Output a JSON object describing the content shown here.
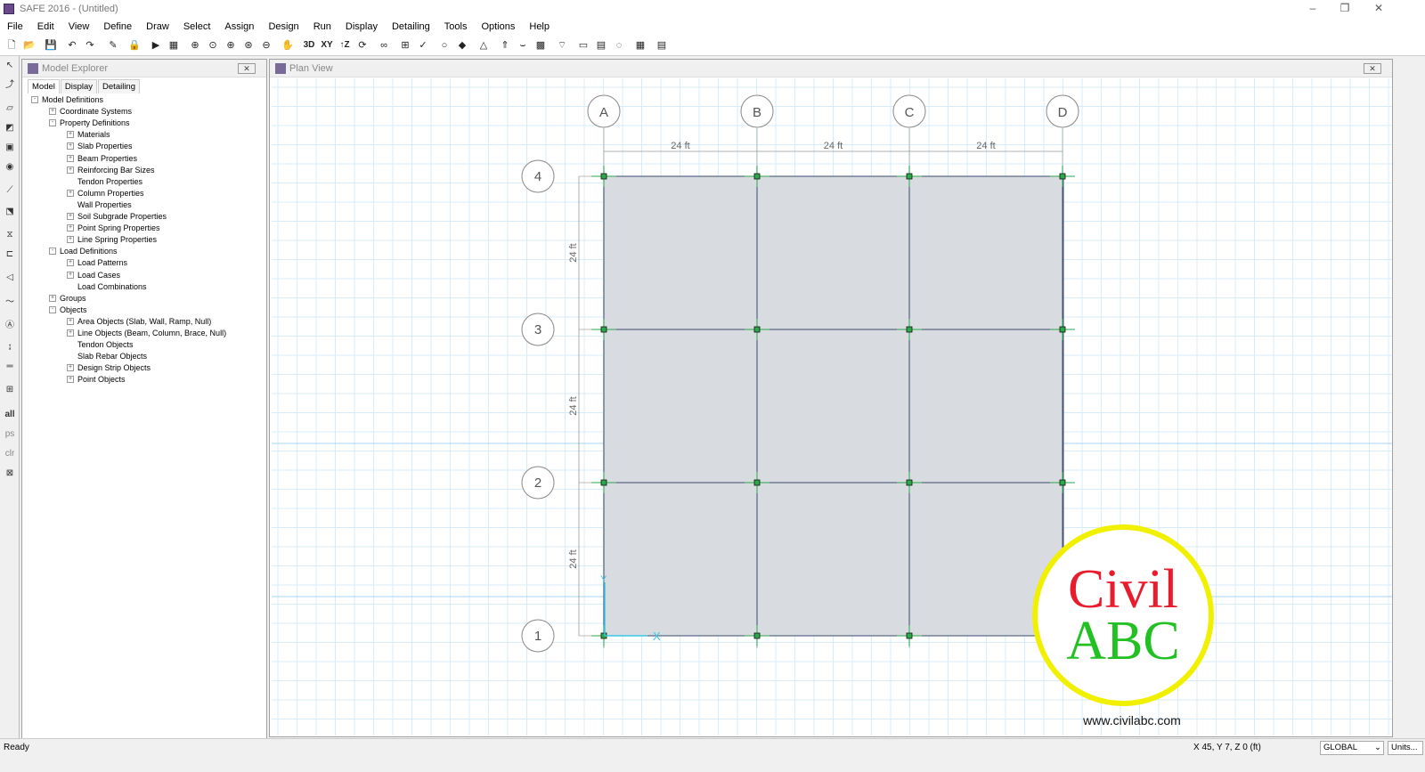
{
  "window": {
    "title": "SAFE 2016 - (Untitled)",
    "minimize": "–",
    "restore": "❐",
    "close": "✕"
  },
  "menu": [
    "File",
    "Edit",
    "View",
    "Define",
    "Draw",
    "Select",
    "Assign",
    "Design",
    "Run",
    "Display",
    "Detailing",
    "Tools",
    "Options",
    "Help"
  ],
  "toolbar": {
    "icons": [
      "new-file-icon",
      "open-folder-icon",
      "save-icon",
      "undo-icon",
      "redo-icon",
      "pencil-icon",
      "lock-icon",
      "run-icon",
      "stop-icon",
      "zoom-window-icon",
      "zoom-previous-icon",
      "zoom-in-icon",
      "zoom-out-icon",
      "pan-icon",
      "zoom-fit-icon",
      "refresh-icon"
    ],
    "view3d": "3D",
    "viewxy": "XY",
    "viewz": "↑Z"
  },
  "explorer": {
    "title": "Model Explorer",
    "close": "✕",
    "tabs": [
      "Model",
      "Display",
      "Detailing"
    ],
    "tree": [
      {
        "label": "Model Definitions",
        "level": 0,
        "exp": "-"
      },
      {
        "label": "Coordinate Systems",
        "level": 1,
        "exp": "+"
      },
      {
        "label": "Property Definitions",
        "level": 1,
        "exp": "-"
      },
      {
        "label": "Materials",
        "level": 2,
        "exp": "+"
      },
      {
        "label": "Slab Properties",
        "level": 2,
        "exp": "+"
      },
      {
        "label": "Beam Properties",
        "level": 2,
        "exp": "+"
      },
      {
        "label": "Reinforcing Bar Sizes",
        "level": 2,
        "exp": "+"
      },
      {
        "label": "Tendon Properties",
        "level": 2,
        "exp": ""
      },
      {
        "label": "Column Properties",
        "level": 2,
        "exp": "+"
      },
      {
        "label": "Wall Properties",
        "level": 2,
        "exp": ""
      },
      {
        "label": "Soil Subgrade Properties",
        "level": 2,
        "exp": "+"
      },
      {
        "label": "Point Spring Properties",
        "level": 2,
        "exp": "+"
      },
      {
        "label": "Line Spring Properties",
        "level": 2,
        "exp": "+"
      },
      {
        "label": "Load Definitions",
        "level": 1,
        "exp": "-"
      },
      {
        "label": "Load Patterns",
        "level": 2,
        "exp": "+"
      },
      {
        "label": "Load Cases",
        "level": 2,
        "exp": "+"
      },
      {
        "label": "Load Combinations",
        "level": 2,
        "exp": ""
      },
      {
        "label": "Groups",
        "level": 1,
        "exp": "+"
      },
      {
        "label": "Objects",
        "level": 1,
        "exp": "-"
      },
      {
        "label": "Area Objects (Slab, Wall, Ramp, Null)",
        "level": 2,
        "exp": "+"
      },
      {
        "label": "Line Objects (Beam, Column, Brace, Null)",
        "level": 2,
        "exp": "+"
      },
      {
        "label": "Tendon Objects",
        "level": 2,
        "exp": ""
      },
      {
        "label": "Slab Rebar Objects",
        "level": 2,
        "exp": ""
      },
      {
        "label": "Design Strip Objects",
        "level": 2,
        "exp": "+"
      },
      {
        "label": "Point Objects",
        "level": 2,
        "exp": "+"
      }
    ]
  },
  "lefttools": [
    "↖",
    "⤴",
    "▱",
    "◩",
    "▣",
    "◉",
    "⟋",
    "⬔",
    "⧖",
    "⊏",
    "◁",
    "〜",
    "Ⓐ",
    "↨",
    "═",
    "⊞",
    "all",
    "ps",
    "clr",
    "⊠"
  ],
  "plan": {
    "title": "Plan View",
    "close": "✕",
    "grid_x": [
      "A",
      "B",
      "C",
      "D"
    ],
    "grid_y": [
      "4",
      "3",
      "2",
      "1"
    ],
    "dim_x": [
      "24 ft",
      "24 ft",
      "24 ft"
    ],
    "dim_y": [
      "24 ft",
      "24 ft",
      "24 ft"
    ],
    "axis_x": "X",
    "axis_y": "Y"
  },
  "watermark": {
    "line1": "Civil",
    "line2": "ABC",
    "url": "www.civilabc.com"
  },
  "colors": {
    "slab": "#d8dbe0",
    "grid": "#c8e6f8",
    "node": "#2aa84a",
    "axis": "#3cc8e8",
    "civil": "#e81c2c",
    "abc": "#22c022",
    "ring": "#f0f000"
  },
  "status": {
    "ready": "Ready",
    "coords": "X 45, Y 7, Z 0  (ft)",
    "system": "GLOBAL",
    "units": "Units..."
  }
}
